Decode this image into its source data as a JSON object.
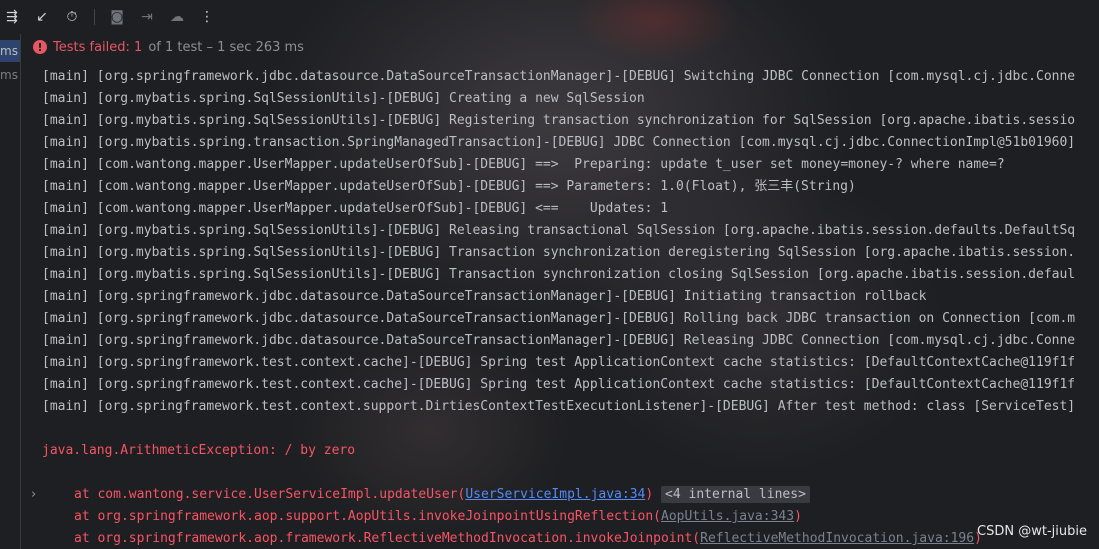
{
  "toolbar": {
    "icons": [
      "filter-lines-icon",
      "import-icon",
      "history-icon",
      "camera-icon",
      "export-icon",
      "cloud-icon",
      "more-icon"
    ]
  },
  "left_panel": {
    "items": [
      "ms",
      "ms"
    ]
  },
  "status": {
    "failed_label": "Tests failed: 1",
    "rest": "of 1 test – 1 sec 263 ms"
  },
  "console": {
    "log_lines": [
      "[main] [org.springframework.jdbc.datasource.DataSourceTransactionManager]-[DEBUG] Switching JDBC Connection [com.mysql.cj.jdbc.Conne",
      "[main] [org.mybatis.spring.SqlSessionUtils]-[DEBUG] Creating a new SqlSession",
      "[main] [org.mybatis.spring.SqlSessionUtils]-[DEBUG] Registering transaction synchronization for SqlSession [org.apache.ibatis.sessio",
      "[main] [org.mybatis.spring.transaction.SpringManagedTransaction]-[DEBUG] JDBC Connection [com.mysql.cj.jdbc.ConnectionImpl@51b01960]",
      "[main] [com.wantong.mapper.UserMapper.updateUserOfSub]-[DEBUG] ==>  Preparing: update t_user set money=money-? where name=?",
      "[main] [com.wantong.mapper.UserMapper.updateUserOfSub]-[DEBUG] ==> Parameters: 1.0(Float), 张三丰(String)",
      "[main] [com.wantong.mapper.UserMapper.updateUserOfSub]-[DEBUG] <==    Updates: 1",
      "[main] [org.mybatis.spring.SqlSessionUtils]-[DEBUG] Releasing transactional SqlSession [org.apache.ibatis.session.defaults.DefaultSq",
      "[main] [org.mybatis.spring.SqlSessionUtils]-[DEBUG] Transaction synchronization deregistering SqlSession [org.apache.ibatis.session.",
      "[main] [org.mybatis.spring.SqlSessionUtils]-[DEBUG] Transaction synchronization closing SqlSession [org.apache.ibatis.session.defaul",
      "[main] [org.springframework.jdbc.datasource.DataSourceTransactionManager]-[DEBUG] Initiating transaction rollback",
      "[main] [org.springframework.jdbc.datasource.DataSourceTransactionManager]-[DEBUG] Rolling back JDBC transaction on Connection [com.m",
      "[main] [org.springframework.jdbc.datasource.DataSourceTransactionManager]-[DEBUG] Releasing JDBC Connection [com.mysql.cj.jdbc.Conne",
      "[main] [org.springframework.test.context.cache]-[DEBUG] Spring test ApplicationContext cache statistics: [DefaultContextCache@119f1f",
      "[main] [org.springframework.test.context.cache]-[DEBUG] Spring test ApplicationContext cache statistics: [DefaultContextCache@119f1f",
      "[main] [org.springframework.test.context.support.DirtiesContextTestExecutionListener]-[DEBUG] After test method: class [ServiceTest]"
    ],
    "exception": "java.lang.ArithmeticException: / by zero",
    "stack": [
      {
        "prefix": "at com.wantong.service.UserServiceImpl.updateUser(",
        "link": "UserServiceImpl.java:34",
        "suffix": ")",
        "extra": "<4 internal lines>"
      },
      {
        "prefix": "at org.springframework.aop.support.AopUtils.invokeJoinpointUsingReflection(",
        "link": "AopUtils.java:343",
        "suffix": ")",
        "extra": ""
      },
      {
        "prefix": "at org.springframework.aop.framework.ReflectiveMethodInvocation.invokeJoinpoint(",
        "link": "ReflectiveMethodInvocation.java:196",
        "suffix": ")",
        "extra": ""
      }
    ]
  },
  "watermark": "CSDN @wt-jiubie",
  "colors": {
    "background": "#1e1f22",
    "error": "#f75464",
    "link": "#548af7",
    "selection": "#2e436e"
  }
}
